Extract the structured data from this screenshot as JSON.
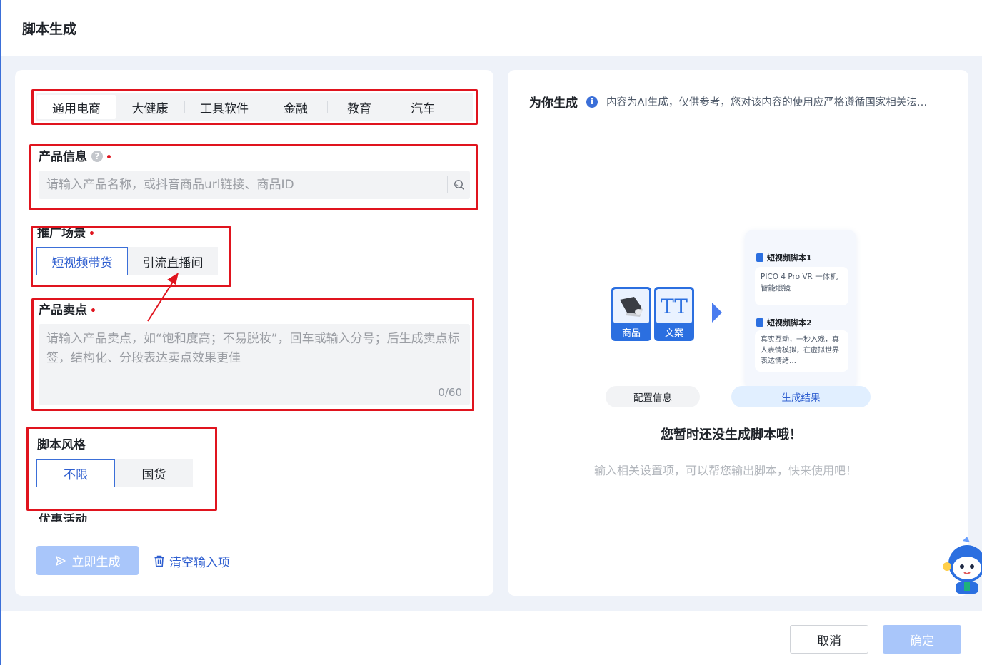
{
  "dialog": {
    "title": "脚本生成"
  },
  "tabs": [
    {
      "label": "通用电商",
      "active": true
    },
    {
      "label": "大健康",
      "active": false
    },
    {
      "label": "工具软件",
      "active": false
    },
    {
      "label": "金融",
      "active": false
    },
    {
      "label": "教育",
      "active": false
    },
    {
      "label": "汽车",
      "active": false
    }
  ],
  "product_info": {
    "label": "产品信息",
    "help_icon": "question-circle-icon",
    "required_mark": "•",
    "placeholder": "请输入产品名称，或抖音商品url链接、商品ID",
    "search_icon": "search-icon"
  },
  "promo_scene": {
    "label": "推广场景",
    "required_mark": "•",
    "options": [
      "短视频带货",
      "引流直播间"
    ],
    "selected": "短视频带货"
  },
  "selling_points": {
    "label": "产品卖点",
    "required_mark": "•",
    "placeholder": "请输入产品卖点，如“饱和度高；不易脱妆”，回车或输入分号；后生成卖点标签，结构化、分段表达卖点效果更佳",
    "counter": "0/60"
  },
  "script_style": {
    "label": "脚本风格",
    "options": [
      "不限",
      "国货"
    ],
    "selected": "不限"
  },
  "promotion": {
    "label": "优惠活动"
  },
  "actions": {
    "generate_label": "立即生成",
    "clear_label": "清空输入项"
  },
  "result_panel": {
    "title": "为你生成",
    "notice": "内容为AI生成，仅供参考，您对该内容的使用应严格遵循国家相关法…",
    "illustration": {
      "product_card": "商品",
      "copy_card": "文案",
      "copy_card_glyph": "TT",
      "script1_title": "短视频脚本1",
      "script1_text": "PICO 4 Pro VR 一体机智能眼镜",
      "script2_title": "短视频脚本2",
      "script2_text": "真实互动，一秒入戏，真人表情模拟，在虚拟世界表达情绪…",
      "config_pill": "配置信息",
      "result_pill": "生成结果"
    },
    "empty_title": "您暂时还没生成脚本哦！",
    "empty_subtitle": "输入相关设置项，可以帮您输出脚本，快来使用吧！"
  },
  "footer": {
    "cancel_label": "取消",
    "confirm_label": "确定"
  },
  "colors": {
    "accent": "#2f5fd0",
    "disabled_button": "#a9c6fa",
    "annotation_red": "#e0141e"
  }
}
